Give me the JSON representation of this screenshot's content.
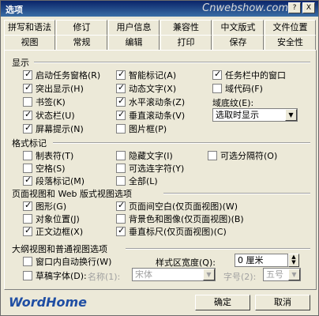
{
  "window": {
    "title": "选项",
    "watermark": "Cnwebshow.com",
    "help_button": "?",
    "close_button": "X"
  },
  "tabs": {
    "row1": [
      "拼写和语法",
      "修订",
      "用户信息",
      "兼容性",
      "中文版式",
      "文件位置"
    ],
    "row2": [
      "视图",
      "常规",
      "编辑",
      "打印",
      "保存",
      "安全性"
    ]
  },
  "display": {
    "title": "显示",
    "items": [
      {
        "label": "启动任务窗格(R)",
        "checked": true
      },
      {
        "label": "突出显示(H)",
        "checked": true
      },
      {
        "label": "书签(K)",
        "checked": false
      },
      {
        "label": "状态栏(U)",
        "checked": true
      },
      {
        "label": "屏幕提示(N)",
        "checked": true
      },
      {
        "label": "智能标记(A)",
        "checked": true
      },
      {
        "label": "动态文字(X)",
        "checked": true
      },
      {
        "label": "水平滚动条(Z)",
        "checked": true
      },
      {
        "label": "垂直滚动条(V)",
        "checked": true
      },
      {
        "label": "图片框(P)",
        "checked": false
      },
      {
        "label": "任务栏中的窗口",
        "checked": true
      },
      {
        "label": "域代码(F)",
        "checked": false
      }
    ],
    "shading_label": "域底纹(E):",
    "shading_value": "选取时显示"
  },
  "format_marks": {
    "title": "格式标记",
    "items": [
      {
        "label": "制表符(T)",
        "checked": false
      },
      {
        "label": "空格(S)",
        "checked": false
      },
      {
        "label": "段落标记(M)",
        "checked": true
      },
      {
        "label": "隐藏文字(I)",
        "checked": false
      },
      {
        "label": "可选连字符(Y)",
        "checked": false
      },
      {
        "label": "全部(L)",
        "checked": false
      },
      {
        "label": "可选分隔符(O)",
        "checked": false
      }
    ]
  },
  "page_web": {
    "title": "页面视图和 Web 版式视图选项",
    "items": [
      {
        "label": "图形(G)",
        "checked": true
      },
      {
        "label": "对象位置(J)",
        "checked": false
      },
      {
        "label": "正文边框(X)",
        "checked": true
      },
      {
        "label": "页面间空白(仅页面视图)(W)",
        "checked": true
      },
      {
        "label": "背景色和图像(仅页面视图)(B)",
        "checked": false
      },
      {
        "label": "垂直标尺(仅页面视图)(C)",
        "checked": true
      }
    ]
  },
  "outline": {
    "title": "大纲视图和普通视图选项",
    "wrap_label": "窗口内自动换行(W)",
    "draft_label": "草稿字体(D):",
    "name_label": "名称(1):",
    "name_value": "宋体",
    "size_label": "字号(2):",
    "size_value": "五号",
    "style_width_label": "样式区宽度(Q):",
    "style_width_value": "0 厘米"
  },
  "footer": {
    "logo": "WordHome",
    "ok": "确定",
    "cancel": "取消"
  }
}
